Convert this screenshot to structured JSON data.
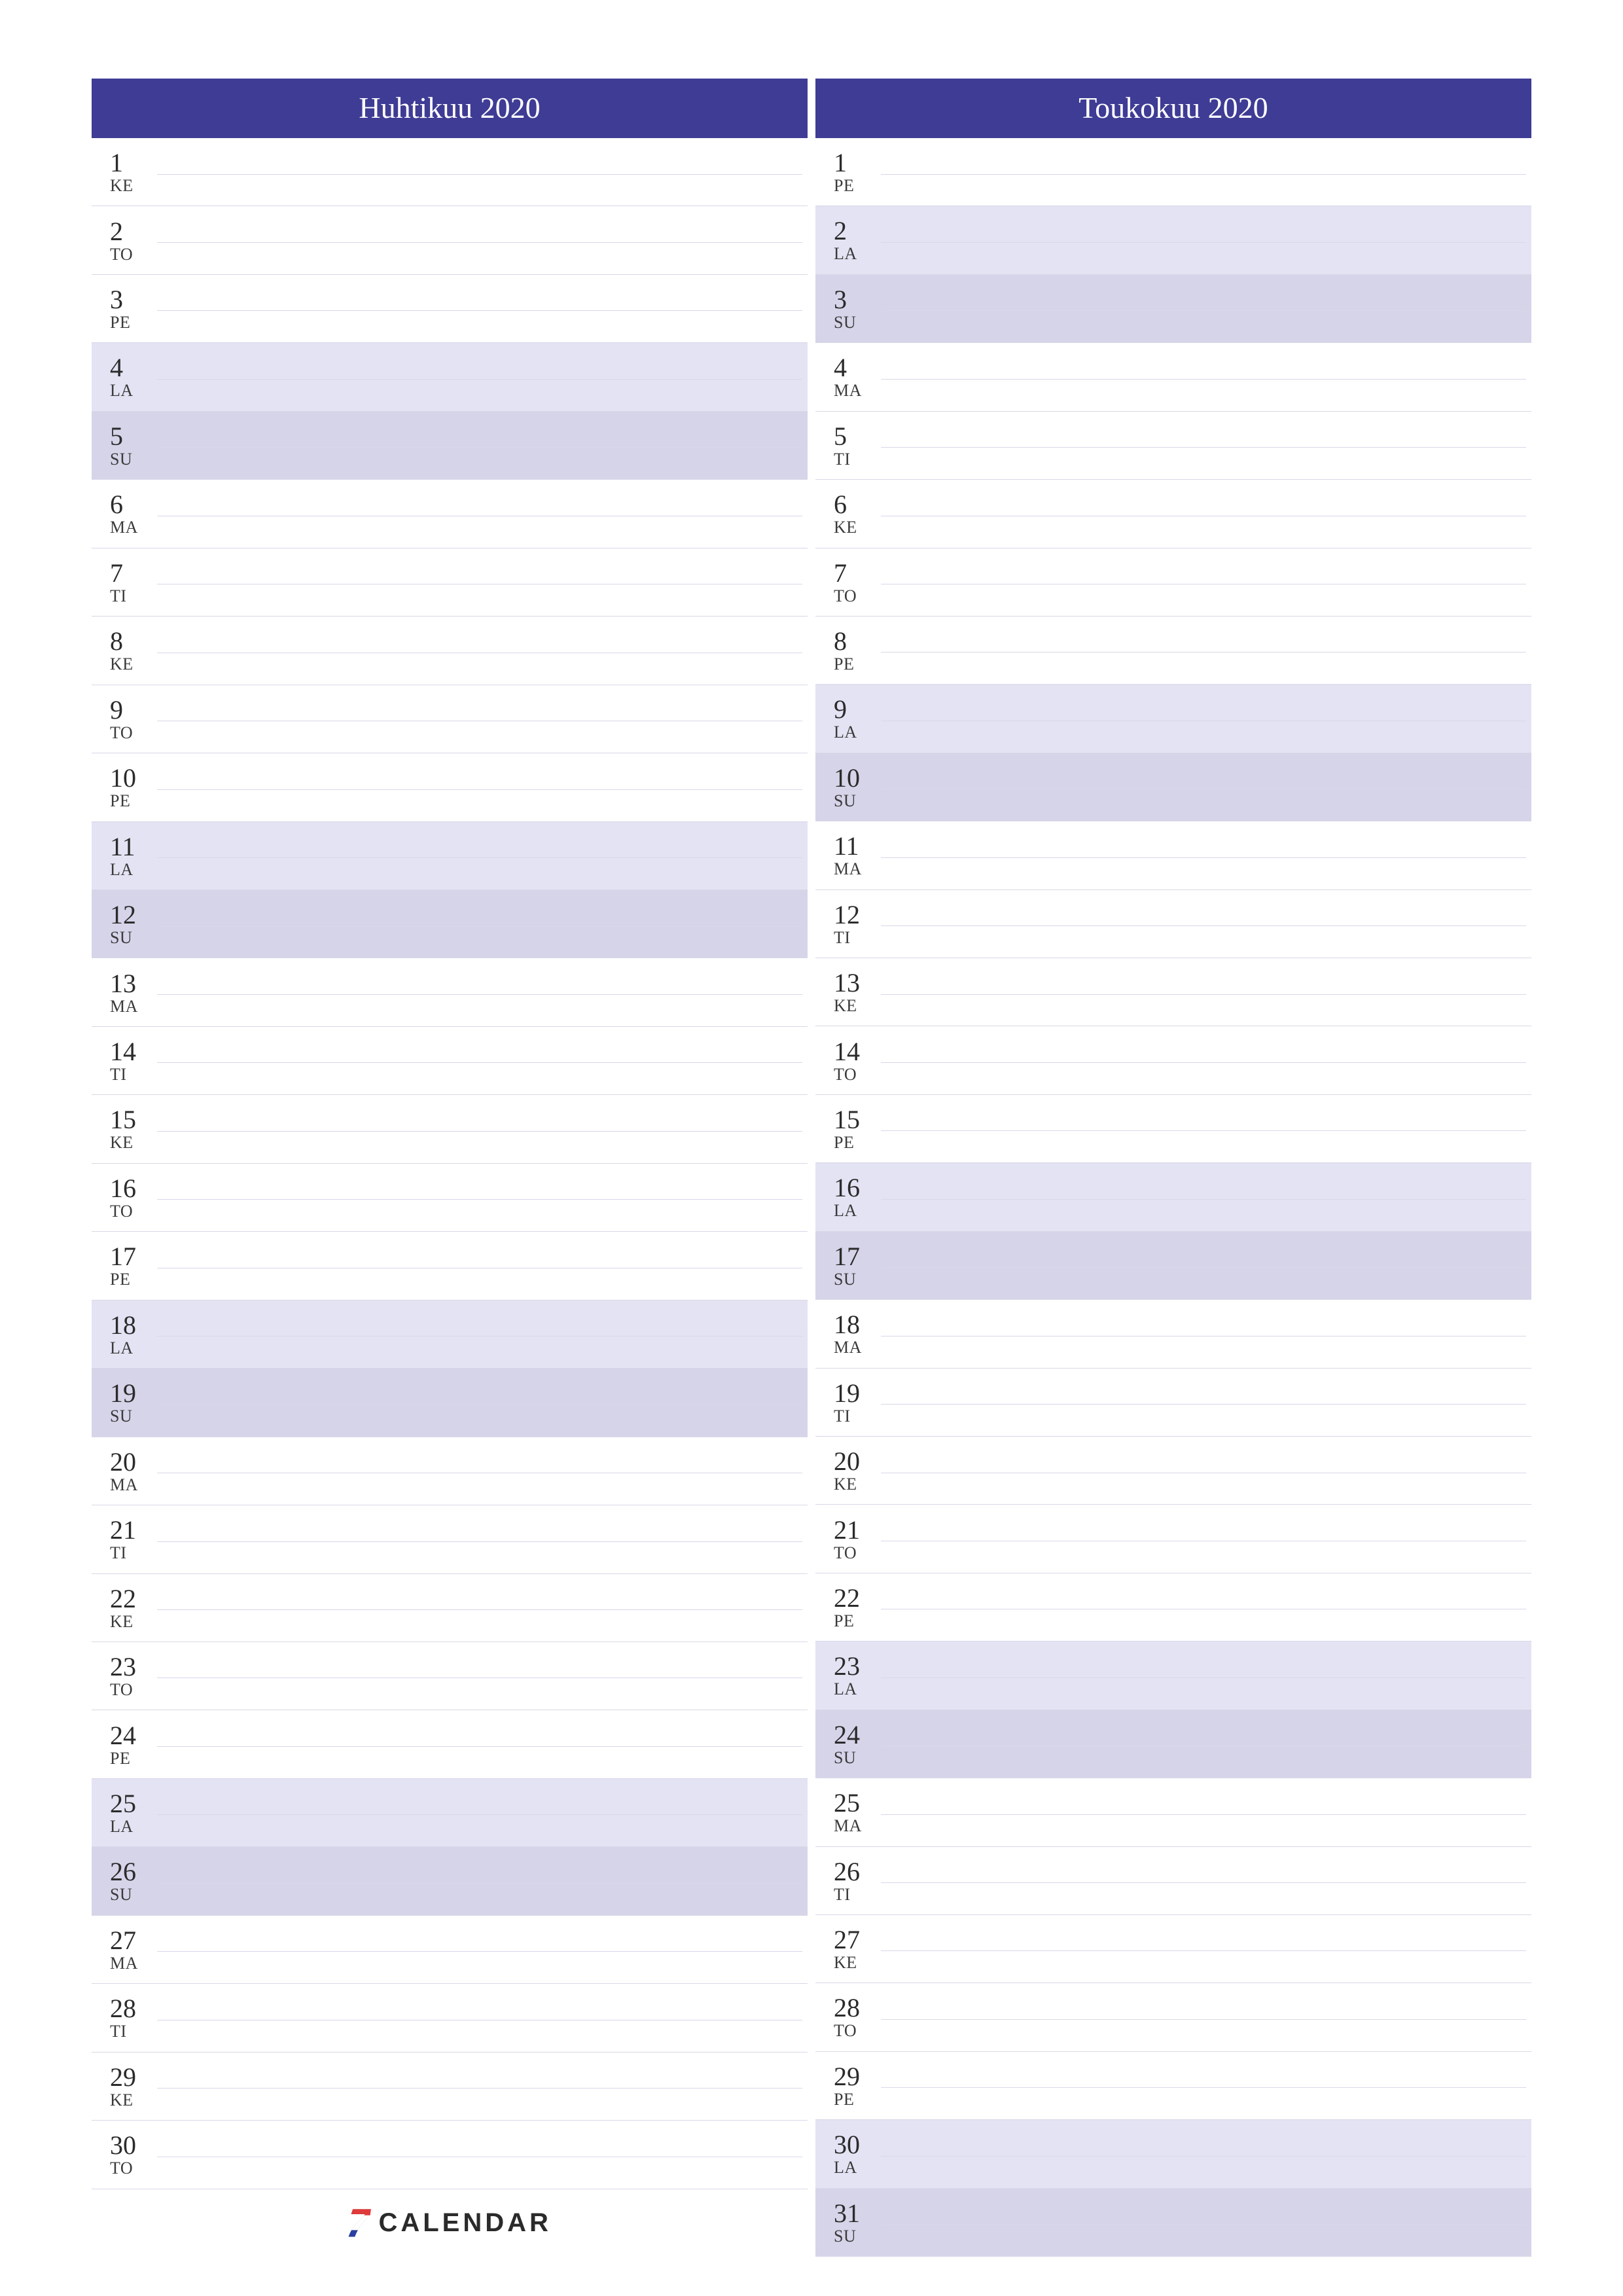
{
  "brand": {
    "seven": "7",
    "name": "CALENDAR"
  },
  "weekday_type": {
    "MA": "weekday",
    "TI": "weekday",
    "KE": "weekday",
    "TO": "weekday",
    "PE": "weekday",
    "LA": "sat",
    "SU": "sun"
  },
  "months": [
    {
      "title": "Huhtikuu 2020",
      "footer_logo": true,
      "days": [
        {
          "n": "1",
          "w": "KE"
        },
        {
          "n": "2",
          "w": "TO"
        },
        {
          "n": "3",
          "w": "PE"
        },
        {
          "n": "4",
          "w": "LA"
        },
        {
          "n": "5",
          "w": "SU"
        },
        {
          "n": "6",
          "w": "MA"
        },
        {
          "n": "7",
          "w": "TI"
        },
        {
          "n": "8",
          "w": "KE"
        },
        {
          "n": "9",
          "w": "TO"
        },
        {
          "n": "10",
          "w": "PE"
        },
        {
          "n": "11",
          "w": "LA"
        },
        {
          "n": "12",
          "w": "SU"
        },
        {
          "n": "13",
          "w": "MA"
        },
        {
          "n": "14",
          "w": "TI"
        },
        {
          "n": "15",
          "w": "KE"
        },
        {
          "n": "16",
          "w": "TO"
        },
        {
          "n": "17",
          "w": "PE"
        },
        {
          "n": "18",
          "w": "LA"
        },
        {
          "n": "19",
          "w": "SU"
        },
        {
          "n": "20",
          "w": "MA"
        },
        {
          "n": "21",
          "w": "TI"
        },
        {
          "n": "22",
          "w": "KE"
        },
        {
          "n": "23",
          "w": "TO"
        },
        {
          "n": "24",
          "w": "PE"
        },
        {
          "n": "25",
          "w": "LA"
        },
        {
          "n": "26",
          "w": "SU"
        },
        {
          "n": "27",
          "w": "MA"
        },
        {
          "n": "28",
          "w": "TI"
        },
        {
          "n": "29",
          "w": "KE"
        },
        {
          "n": "30",
          "w": "TO"
        }
      ]
    },
    {
      "title": "Toukokuu 2020",
      "footer_logo": false,
      "days": [
        {
          "n": "1",
          "w": "PE"
        },
        {
          "n": "2",
          "w": "LA"
        },
        {
          "n": "3",
          "w": "SU"
        },
        {
          "n": "4",
          "w": "MA"
        },
        {
          "n": "5",
          "w": "TI"
        },
        {
          "n": "6",
          "w": "KE"
        },
        {
          "n": "7",
          "w": "TO"
        },
        {
          "n": "8",
          "w": "PE"
        },
        {
          "n": "9",
          "w": "LA"
        },
        {
          "n": "10",
          "w": "SU"
        },
        {
          "n": "11",
          "w": "MA"
        },
        {
          "n": "12",
          "w": "TI"
        },
        {
          "n": "13",
          "w": "KE"
        },
        {
          "n": "14",
          "w": "TO"
        },
        {
          "n": "15",
          "w": "PE"
        },
        {
          "n": "16",
          "w": "LA"
        },
        {
          "n": "17",
          "w": "SU"
        },
        {
          "n": "18",
          "w": "MA"
        },
        {
          "n": "19",
          "w": "TI"
        },
        {
          "n": "20",
          "w": "KE"
        },
        {
          "n": "21",
          "w": "TO"
        },
        {
          "n": "22",
          "w": "PE"
        },
        {
          "n": "23",
          "w": "LA"
        },
        {
          "n": "24",
          "w": "SU"
        },
        {
          "n": "25",
          "w": "MA"
        },
        {
          "n": "26",
          "w": "TI"
        },
        {
          "n": "27",
          "w": "KE"
        },
        {
          "n": "28",
          "w": "TO"
        },
        {
          "n": "29",
          "w": "PE"
        },
        {
          "n": "30",
          "w": "LA"
        },
        {
          "n": "31",
          "w": "SU"
        }
      ]
    }
  ]
}
